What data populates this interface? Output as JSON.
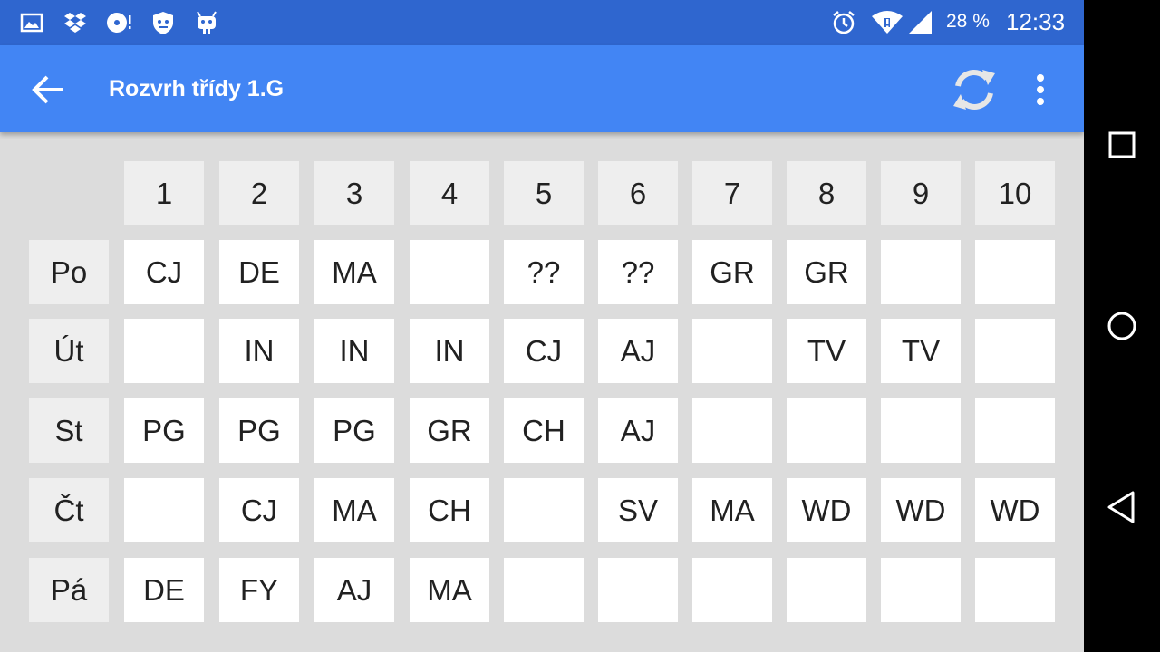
{
  "status_bar": {
    "icons": [
      "image-icon",
      "dropbox-icon",
      "cd-alert-icon",
      "shield-icon",
      "android-icon"
    ],
    "right_icons": [
      "alarm-icon",
      "wifi-icon",
      "signal-icon"
    ],
    "battery": "28 %",
    "time": "12:33"
  },
  "app_bar": {
    "title": "Rozvrh třídy 1.G",
    "back_icon": "arrow-left-icon",
    "refresh_icon": "refresh-icon",
    "overflow_icon": "more-vert-icon"
  },
  "timetable": {
    "periods": [
      "1",
      "2",
      "3",
      "4",
      "5",
      "6",
      "7",
      "8",
      "9",
      "10"
    ],
    "days": [
      {
        "label": "Po",
        "slots": [
          "CJ",
          "DE",
          "MA",
          "",
          "??",
          "??",
          "GR",
          "GR",
          "",
          ""
        ]
      },
      {
        "label": "Út",
        "slots": [
          "",
          "IN",
          "IN",
          "IN",
          "CJ",
          "AJ",
          "",
          "TV",
          "TV",
          ""
        ]
      },
      {
        "label": "St",
        "slots": [
          "PG",
          "PG",
          "PG",
          "GR",
          "CH",
          "AJ",
          "",
          "",
          "",
          ""
        ]
      },
      {
        "label": "Čt",
        "slots": [
          "",
          "CJ",
          "MA",
          "CH",
          "",
          "SV",
          "MA",
          "WD",
          "WD",
          "WD"
        ]
      },
      {
        "label": "Pá",
        "slots": [
          "DE",
          "FY",
          "AJ",
          "MA",
          "",
          "",
          "",
          "",
          "",
          ""
        ]
      }
    ]
  },
  "nav_bar": {
    "buttons": [
      "recents-square-icon",
      "home-circle-icon",
      "back-triangle-icon"
    ]
  },
  "colors": {
    "status_bar": "#2f66cf",
    "app_bar": "#4285f4",
    "background": "#dcdcdc",
    "header_cell": "#eeeeee",
    "slot_cell": "#ffffff"
  }
}
